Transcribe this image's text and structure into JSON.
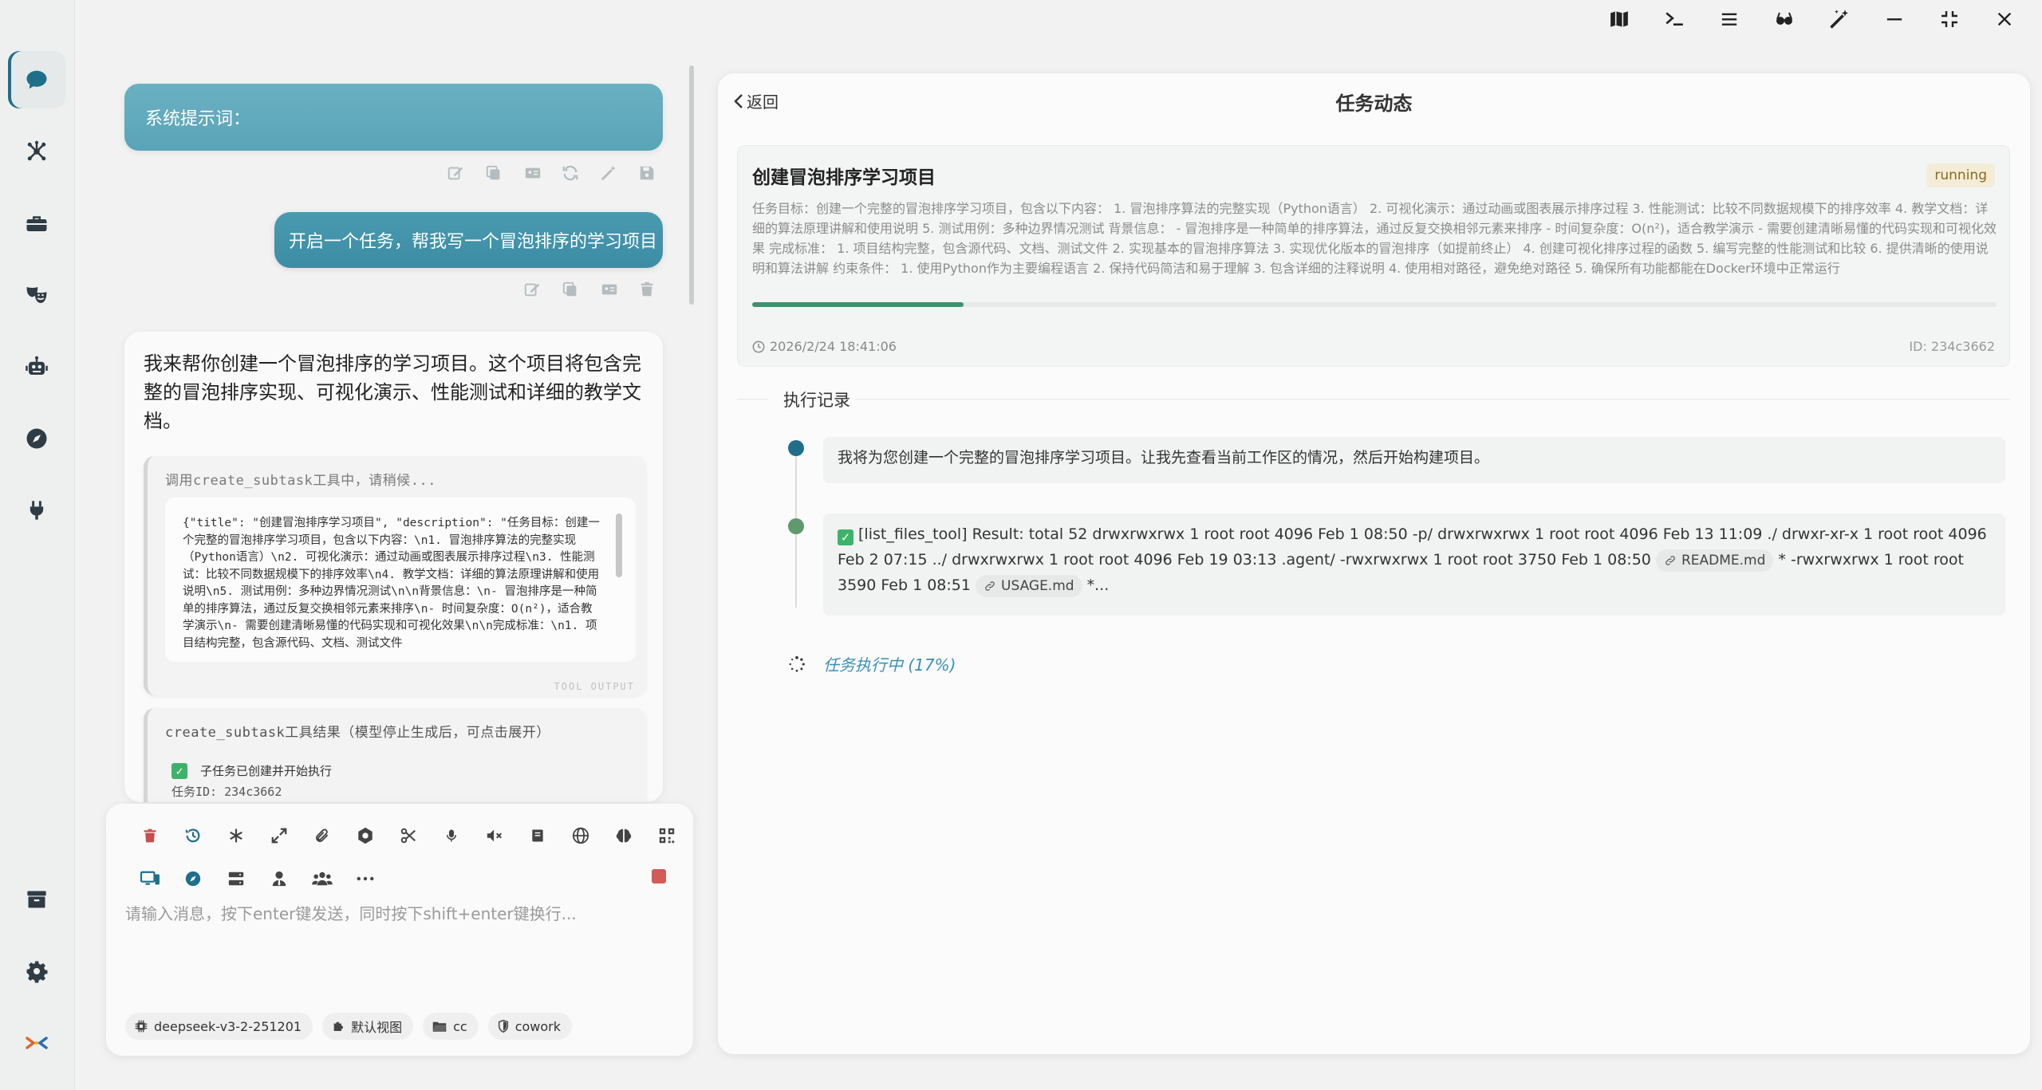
{
  "app": {
    "window_buttons": [
      "map-icon",
      "terminal-icon",
      "menu-icon",
      "glasses-icon",
      "magic-wand-icon",
      "minimize-icon",
      "restore-icon",
      "close-icon"
    ]
  },
  "sidebar": {
    "items": [
      {
        "name": "chat",
        "icon": "chat-icon",
        "active": true
      },
      {
        "name": "agents",
        "icon": "network-icon"
      },
      {
        "name": "toolbox",
        "icon": "toolbox-icon"
      },
      {
        "name": "masks",
        "icon": "masks-icon"
      },
      {
        "name": "robot",
        "icon": "robot-icon"
      },
      {
        "name": "explore",
        "icon": "compass-icon"
      },
      {
        "name": "plugins",
        "icon": "plug-icon"
      }
    ],
    "bottom": [
      {
        "name": "archive",
        "icon": "archive-icon"
      },
      {
        "name": "settings",
        "icon": "gear-icon"
      },
      {
        "name": "logo",
        "icon": "logo-icon"
      }
    ]
  },
  "chat": {
    "system_prompt_label": "系统提示词：",
    "user_message": "开启一个任务，帮我写一个冒泡排序的学习项目",
    "assistant_message": "我来帮你创建一个冒泡排序的学习项目。这个项目将包含完整的冒泡排序实现、可视化演示、性能测试和详细的教学文档。",
    "tool_call": {
      "header": "调用create_subtask工具中，请稍候...",
      "content": "{\"title\": \"创建冒泡排序学习项目\", \"description\": \"任务目标：创建一个完整的冒泡排序学习项目，包含以下内容：\\n1. 冒泡排序算法的完整实现（Python语言）\\n2. 可视化演示：通过动画或图表展示排序过程\\n3. 性能测试：比较不同数据规模下的排序效率\\n4. 教学文档：详细的算法原理讲解和使用说明\\n5. 测试用例：多种边界情况测试\\n\\n背景信息：\\n- 冒泡排序是一种简单的排序算法，通过反复交换相邻元素来排序\\n- 时间复杂度：O(n²)，适合教学演示\\n- 需要创建清晰易懂的代码实现和可视化效果\\n\\n完成标准：\\n1. 项目结构完整，包含源代码、文档、测试文件",
      "footer": "TOOL OUTPUT"
    },
    "tool_result": {
      "header": "create_subtask工具结果（模型停止生成后，可点击展开）",
      "line1": "子任务已创建并开始执行",
      "line2": "任务ID: 234c3662"
    }
  },
  "composer": {
    "placeholder": "请输入消息，按下enter键发送，同时按下shift+enter键换行...",
    "toolbar_row1": [
      "trash-icon",
      "history-icon",
      "asterisk-icon",
      "expand-icon",
      "paperclip-icon",
      "settings-icon",
      "scissors-icon",
      "microphone-icon",
      "mute-icon",
      "book-icon",
      "globe-icon",
      "brain-icon",
      "qrcode-icon"
    ],
    "toolbar_row2": [
      "desktop-icon",
      "compass-icon",
      "server-icon",
      "user-tie-icon",
      "users-icon",
      "more-icon"
    ],
    "chips": [
      {
        "icon": "chip-icon",
        "label": "deepseek-v3-2-251201"
      },
      {
        "icon": "puzzle-icon",
        "label": "默认视图"
      },
      {
        "icon": "folder-icon",
        "label": "cc"
      },
      {
        "icon": "shield-icon",
        "label": "cowork"
      }
    ]
  },
  "panel": {
    "back_label": "返回",
    "title": "任务动态",
    "task": {
      "name": "创建冒泡排序学习项目",
      "status": "running",
      "description": "任务目标：创建一个完整的冒泡排序学习项目，包含以下内容： 1. 冒泡排序算法的完整实现（Python语言） 2. 可视化演示：通过动画或图表展示排序过程 3. 性能测试：比较不同数据规模下的排序效率 4. 教学文档：详细的算法原理讲解和使用说明 5. 测试用例：多种边界情况测试 背景信息： - 冒泡排序是一种简单的排序算法，通过反复交换相邻元素来排序 - 时间复杂度：O(n²)，适合教学演示 - 需要创建清晰易懂的代码实现和可视化效果 完成标准： 1. 项目结构完整，包含源代码、文档、测试文件 2. 实现基本的冒泡排序算法 3. 实现优化版本的冒泡排序（如提前终止） 4. 创建可视化排序过程的函数 5. 编写完整的性能测试和比较 6. 提供清晰的使用说明和算法讲解 约束条件： 1. 使用Python作为主要编程语言 2. 保持代码简洁和易于理解 3. 包含详细的注释说明 4. 使用相对路径，避免绝对路径 5. 确保所有功能都能在Docker环境中正常运行",
      "progress": 0.17,
      "time": "2026/2/24 18:41:06",
      "id": "ID: 234c3662"
    },
    "section_title": "执行记录",
    "records": [
      {
        "text": "我将为您创建一个完整的冒泡排序学习项目。让我先查看当前工作区的情况，然后开始构建项目。"
      },
      {
        "text_a": "[list_files_tool] Result: total 52 drwxrwxrwx 1 root root 4096 Feb 1 08:50 -p/ drwxrwxrwx 1 root root 4096 Feb 13 11:09 ./ drwxr-xr-x 1 root root 4096 Feb 2 07:15 ../ drwxrwxrwx 1 root root 4096 Feb 19 03:13 .agent/ -rwxrwxrwx 1 root root 3750 Feb 1 08:50",
        "file1": "README.md",
        "text_b": "* -rwxrwxrwx 1 root root 3590 Feb 1 08:51",
        "file2": "USAGE.md",
        "text_c": "*..."
      }
    ],
    "running_status": "任务执行中 (17%)"
  },
  "colors": {
    "accent": "#1f6f8b",
    "bubble": "#5aa4b8",
    "progress": "#3d9270",
    "dot_blue": "#1f6f8b",
    "dot_green": "#5e9a6e",
    "running_badge_bg": "#f4ecd6"
  }
}
